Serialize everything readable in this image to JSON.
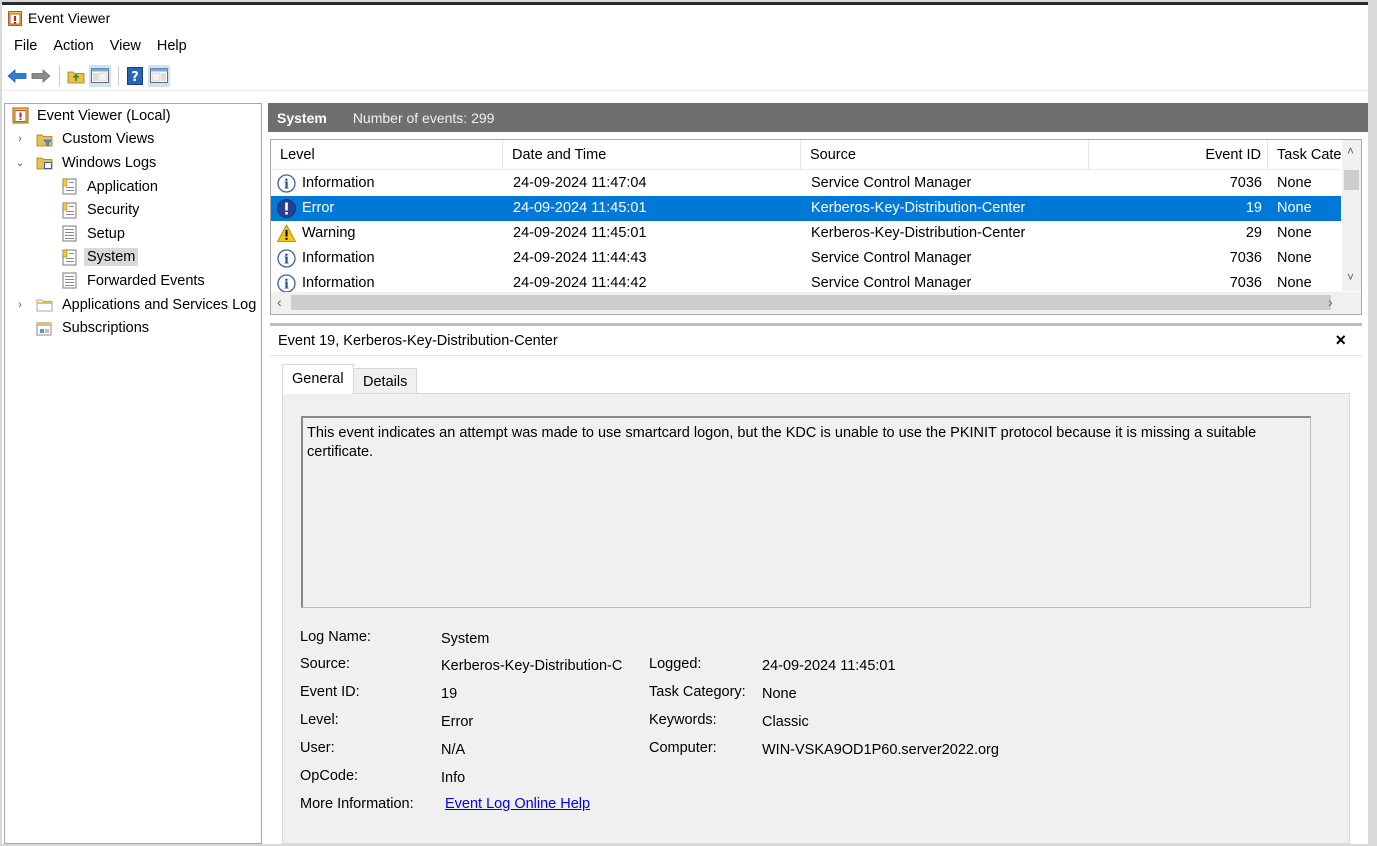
{
  "window": {
    "title": "Event Viewer"
  },
  "menu": [
    "File",
    "Action",
    "View",
    "Help"
  ],
  "toolbar": {
    "buttons": [
      "back-arrow-icon",
      "forward-arrow-icon",
      "up-folder-icon",
      "show-hide-tree-icon",
      "help-icon",
      "show-hide-action-pane-icon"
    ]
  },
  "tree": {
    "items": [
      {
        "label": "Event Viewer (Local)",
        "icon": "event-viewer-icon",
        "level": 0,
        "expander": ""
      },
      {
        "label": "Custom Views",
        "icon": "folder-filter-icon",
        "level": 1,
        "expander": "›"
      },
      {
        "label": "Windows Logs",
        "icon": "folder-logs-icon",
        "level": 1,
        "expander": "⌄"
      },
      {
        "label": "Application",
        "icon": "log-icon",
        "level": 2,
        "expander": ""
      },
      {
        "label": "Security",
        "icon": "log-icon",
        "level": 2,
        "expander": ""
      },
      {
        "label": "Setup",
        "icon": "log-plain-icon",
        "level": 2,
        "expander": ""
      },
      {
        "label": "System",
        "icon": "log-icon",
        "level": 2,
        "expander": "",
        "selected": true
      },
      {
        "label": "Forwarded Events",
        "icon": "log-plain-icon",
        "level": 2,
        "expander": ""
      },
      {
        "label": "Applications and Services Log",
        "icon": "folder-icon",
        "level": 1,
        "expander": "›"
      },
      {
        "label": "Subscriptions",
        "icon": "subscriptions-icon",
        "level": 1,
        "expander": ""
      }
    ]
  },
  "log_header": {
    "name": "System",
    "count_text": "Number of events: 299"
  },
  "event_list": {
    "columns": [
      "Level",
      "Date and Time",
      "Source",
      "Event ID",
      "Task Categ"
    ],
    "rows": [
      {
        "level": "Information",
        "icon": "info-icon",
        "datetime": "24-09-2024 11:47:04",
        "source": "Service Control Manager",
        "event_id": "7036",
        "task": "None"
      },
      {
        "level": "Error",
        "icon": "error-icon",
        "datetime": "24-09-2024 11:45:01",
        "source": "Kerberos-Key-Distribution-Center",
        "event_id": "19",
        "task": "None",
        "selected": true
      },
      {
        "level": "Warning",
        "icon": "warning-icon",
        "datetime": "24-09-2024 11:45:01",
        "source": "Kerberos-Key-Distribution-Center",
        "event_id": "29",
        "task": "None"
      },
      {
        "level": "Information",
        "icon": "info-icon",
        "datetime": "24-09-2024 11:44:43",
        "source": "Service Control Manager",
        "event_id": "7036",
        "task": "None"
      },
      {
        "level": "Information",
        "icon": "info-icon",
        "datetime": "24-09-2024 11:44:42",
        "source": "Service Control Manager",
        "event_id": "7036",
        "task": "None"
      }
    ]
  },
  "detail": {
    "title": "Event 19, Kerberos-Key-Distribution-Center",
    "close": "×",
    "tabs": [
      "General",
      "Details"
    ],
    "description": "This event indicates an attempt was made to use smartcard logon, but the KDC is unable to use the PKINIT protocol because it is missing a suitable certificate.",
    "props": {
      "log_name_label": "Log Name:",
      "log_name": "System",
      "source_label": "Source:",
      "source": "Kerberos-Key-Distribution-C",
      "logged_label": "Logged:",
      "logged": "24-09-2024 11:45:01",
      "event_id_label": "Event ID:",
      "event_id": "19",
      "task_category_label": "Task Category:",
      "task_category": "None",
      "level_label": "Level:",
      "level": "Error",
      "keywords_label": "Keywords:",
      "keywords": "Classic",
      "user_label": "User:",
      "user": "N/A",
      "computer_label": "Computer:",
      "computer": "WIN-VSKA9OD1P60.server2022.org",
      "opcode_label": "OpCode:",
      "opcode": "Info",
      "more_info_label": "More Information:",
      "more_info_link": "Event Log Online Help"
    }
  },
  "colors": {
    "selection": "#0078d7",
    "header_bg": "#6f6f6f",
    "link": "#0000ee"
  }
}
